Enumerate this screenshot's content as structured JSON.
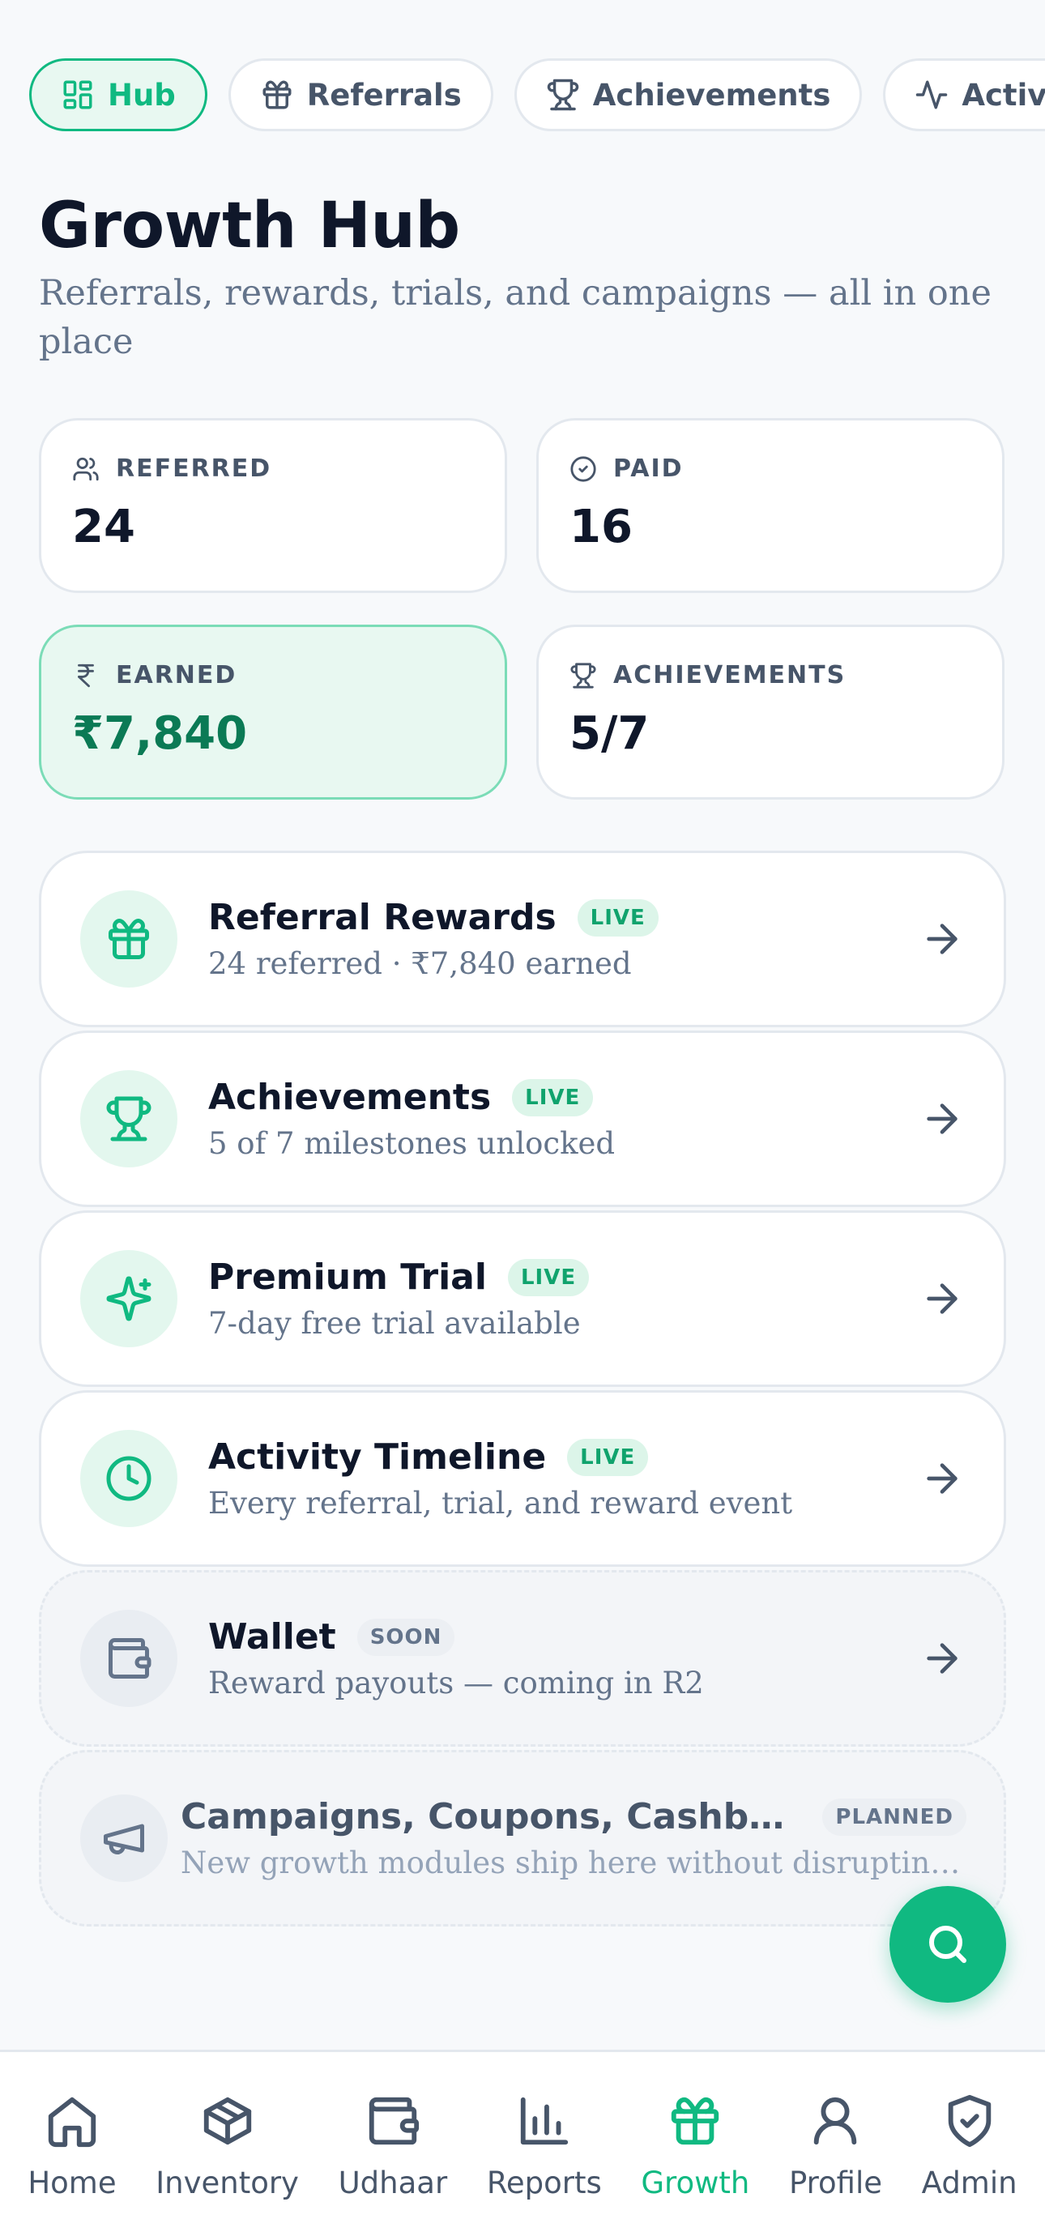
{
  "tabs": [
    {
      "label": "Hub",
      "icon": "grid-icon",
      "active": true
    },
    {
      "label": "Referrals",
      "icon": "gift-icon"
    },
    {
      "label": "Achievements",
      "icon": "trophy-icon"
    },
    {
      "label": "Activity",
      "icon": "activity-icon"
    }
  ],
  "header": {
    "title": "Growth Hub",
    "subtitle": "Referrals, rewards, trials, and campaigns — all in one place"
  },
  "stats": {
    "referred": {
      "label": "REFERRED",
      "value": "24",
      "icon": "users-icon"
    },
    "paid": {
      "label": "PAID",
      "value": "16",
      "icon": "check-circle-icon"
    },
    "earned": {
      "label": "EARNED",
      "value": "₹7,840",
      "icon": "rupee-icon"
    },
    "achievements": {
      "label": "ACHIEVEMENTS",
      "value": "5/7",
      "icon": "trophy-icon"
    }
  },
  "cards": [
    {
      "title": "Referral Rewards",
      "badge": "LIVE",
      "subtitle": "24 referred · ₹7,840 earned",
      "icon": "gift-icon"
    },
    {
      "title": "Achievements",
      "badge": "LIVE",
      "subtitle": "5 of 7 milestones unlocked",
      "icon": "trophy-icon"
    },
    {
      "title": "Premium Trial",
      "badge": "LIVE",
      "subtitle": "7-day free trial available",
      "icon": "sparkles-icon"
    },
    {
      "title": "Activity Timeline",
      "badge": "LIVE",
      "subtitle": "Every referral, trial, and reward event",
      "icon": "clock-icon"
    },
    {
      "title": "Wallet",
      "badge": "SOON",
      "subtitle": "Reward payouts — coming in R2",
      "icon": "wallet-icon"
    },
    {
      "title": "Campaigns, Coupons, Cashbac...",
      "badge": "PLANNED",
      "subtitle": "New growth modules ship here without disrupting...",
      "icon": "megaphone-icon"
    }
  ],
  "fab": {
    "icon": "search-icon"
  },
  "bottom_nav": [
    {
      "label": "Home",
      "icon": "home-icon"
    },
    {
      "label": "Inventory",
      "icon": "box-icon"
    },
    {
      "label": "Udhaar",
      "icon": "wallet-icon"
    },
    {
      "label": "Reports",
      "icon": "bar-chart-icon"
    },
    {
      "label": "Growth",
      "icon": "gift-icon",
      "active": true
    },
    {
      "label": "Profile",
      "icon": "user-icon"
    },
    {
      "label": "Admin",
      "icon": "shield-check-icon"
    }
  ],
  "colors": {
    "accent": "#10b981",
    "accent_dark": "#0b7a55",
    "text": "#0f172a",
    "muted": "#64748b"
  }
}
